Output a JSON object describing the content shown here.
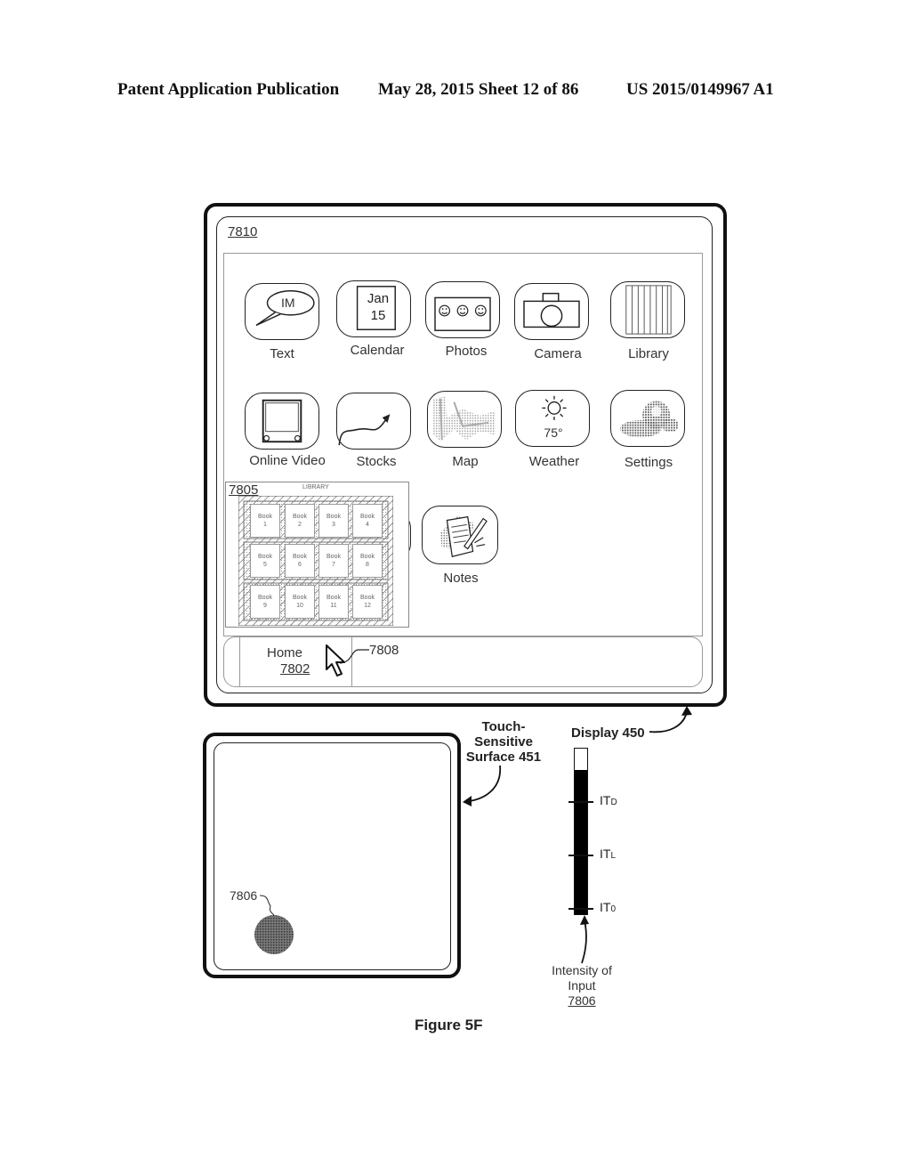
{
  "header": {
    "left": "Patent Application Publication",
    "date_sheet": "May 28, 2015  Sheet 12 of 86",
    "pub_number": "US 2015/0149967 A1"
  },
  "display": {
    "ref": "7810",
    "apps_row1": [
      {
        "label": "Text",
        "icon": "speech-bubble-icon",
        "icon_text": "IM"
      },
      {
        "label": "Calendar",
        "icon": "calendar-icon",
        "icon_text": [
          "Jan",
          "15"
        ]
      },
      {
        "label": "Photos",
        "icon": "photos-icon",
        "icon_text": "☺ ☺ ☺"
      },
      {
        "label": "Camera",
        "icon": "camera-icon"
      },
      {
        "label": "Library",
        "icon": "library-icon"
      }
    ],
    "apps_row2": [
      {
        "label": "Online Video",
        "icon": "tv-icon"
      },
      {
        "label": "Stocks",
        "icon": "stocks-chart-icon"
      },
      {
        "label": "Map",
        "icon": "map-icon"
      },
      {
        "label": "Weather",
        "icon": "sun-icon",
        "icon_text": "75°"
      },
      {
        "label": "Settings",
        "icon": "gears-icon"
      }
    ],
    "apps_row3": [
      {
        "label": "Notes",
        "icon": "notepad-icon"
      }
    ],
    "library_preview": {
      "ref": "7805",
      "title": "LIBRARY",
      "books": [
        "Book 1",
        "Book 2",
        "Book 3",
        "Book 4",
        "Book 5",
        "Book 6",
        "Book 7",
        "Book 8",
        "Book 9",
        "Book 10",
        "Book 11",
        "Book 12"
      ]
    },
    "dock": {
      "home_label": "Home",
      "home_ref": "7802",
      "cursor_ref": "7808"
    },
    "callout": "Display 450"
  },
  "touch_surface": {
    "callout": [
      "Touch-",
      "Sensitive",
      "Surface 451"
    ],
    "contact_ref": "7806"
  },
  "intensity_meter": {
    "thresholds": [
      {
        "main": "IT",
        "sub": "D"
      },
      {
        "main": "IT",
        "sub": "L"
      },
      {
        "main": "IT",
        "sub": "0"
      }
    ],
    "level_fraction_above_ITD": 0.6,
    "caption": [
      "Intensity of",
      "Input"
    ],
    "caption_ref": "7806"
  },
  "figure_caption": "Figure 5F"
}
